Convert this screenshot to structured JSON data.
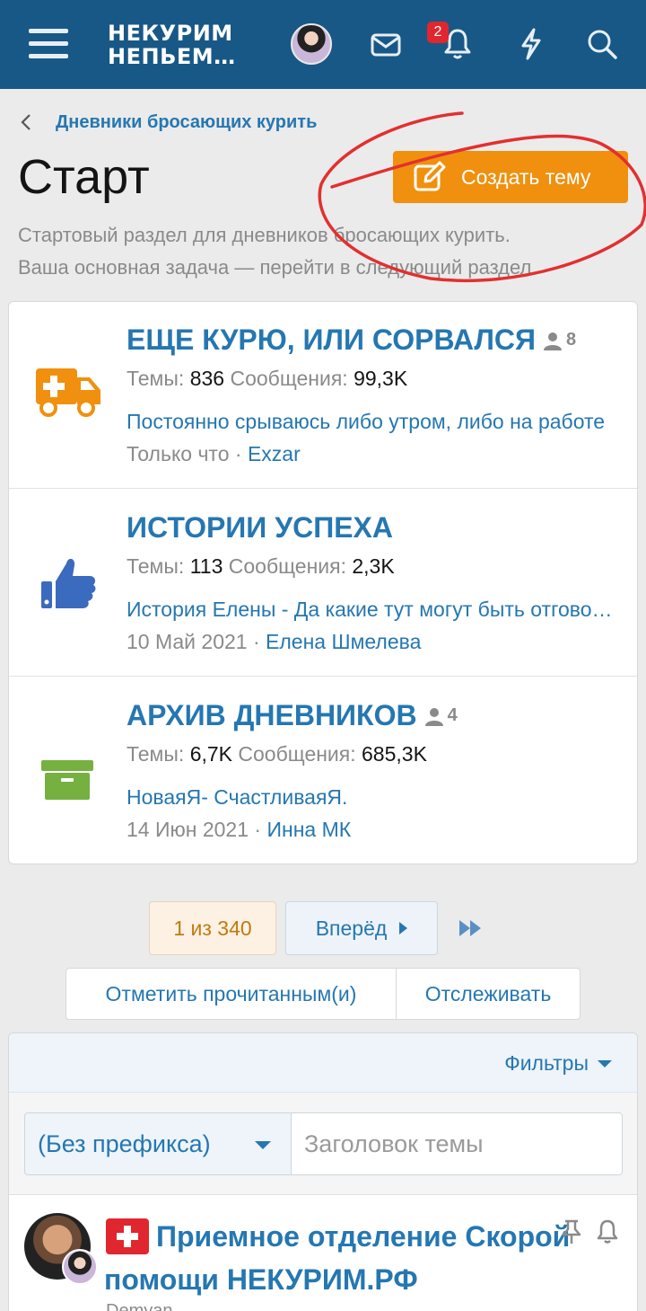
{
  "header": {
    "logo_line1": "НЕКУРИМ",
    "logo_line2": "НЕПЬЕМ…",
    "notifications_count": "2",
    "bg_color": "#185886"
  },
  "breadcrumb": {
    "label": "Дневники бросающих курить"
  },
  "page": {
    "title": "Старт",
    "create_button": "Создать тему",
    "description_line1": "Стартовый раздел для дневников бросающих курить.",
    "description_line2": "Ваша основная задача — перейти в следующий раздел."
  },
  "forums": [
    {
      "title": "ЕЩЕ КУРЮ, ИЛИ СОРВАЛСЯ",
      "users": "8",
      "threads_label": "Темы:",
      "threads": "836",
      "posts_label": "Сообщения:",
      "posts": "99,3K",
      "last_post": "Постоянно срываюсь либо утром, либо на работе",
      "last_time": "Только что",
      "last_user": "Exzar",
      "icon": "ambulance-icon",
      "icon_color": "#f0900e"
    },
    {
      "title": "ИСТОРИИ УСПЕХА",
      "users": "",
      "threads_label": "Темы:",
      "threads": "113",
      "posts_label": "Сообщения:",
      "posts": "2,3K",
      "last_post": "История Елены - Да какие тут могут быть отговорки",
      "last_time": "10 Май 2021",
      "last_user": "Елена Шмелева",
      "icon": "thumbs-up-icon",
      "icon_color": "#3b6bbf"
    },
    {
      "title": "АРХИВ ДНЕВНИКОВ",
      "users": "4",
      "threads_label": "Темы:",
      "threads": "6,7K",
      "posts_label": "Сообщения:",
      "posts": "685,3K",
      "last_post": "НоваяЯ- СчастливаяЯ.",
      "last_time": "14 Июн 2021",
      "last_user": "Инна МК",
      "icon": "archive-box-icon",
      "icon_color": "#76b041"
    }
  ],
  "pagination": {
    "current": "1 из 340",
    "next": "Вперёд"
  },
  "actions": {
    "mark_read": "Отметить прочитанным(и)",
    "watch": "Отслеживать"
  },
  "filters": {
    "label": "Фильтры",
    "prefix_value": "(Без префикса)",
    "title_placeholder": "Заголовок темы"
  },
  "thread": {
    "title": "Приемное отделение Скорой помощи НЕКУРИМ.РФ",
    "author": "Demyan"
  },
  "colors": {
    "link": "#2577b1",
    "accent": "#f0900e",
    "badge": "#e0262e"
  }
}
